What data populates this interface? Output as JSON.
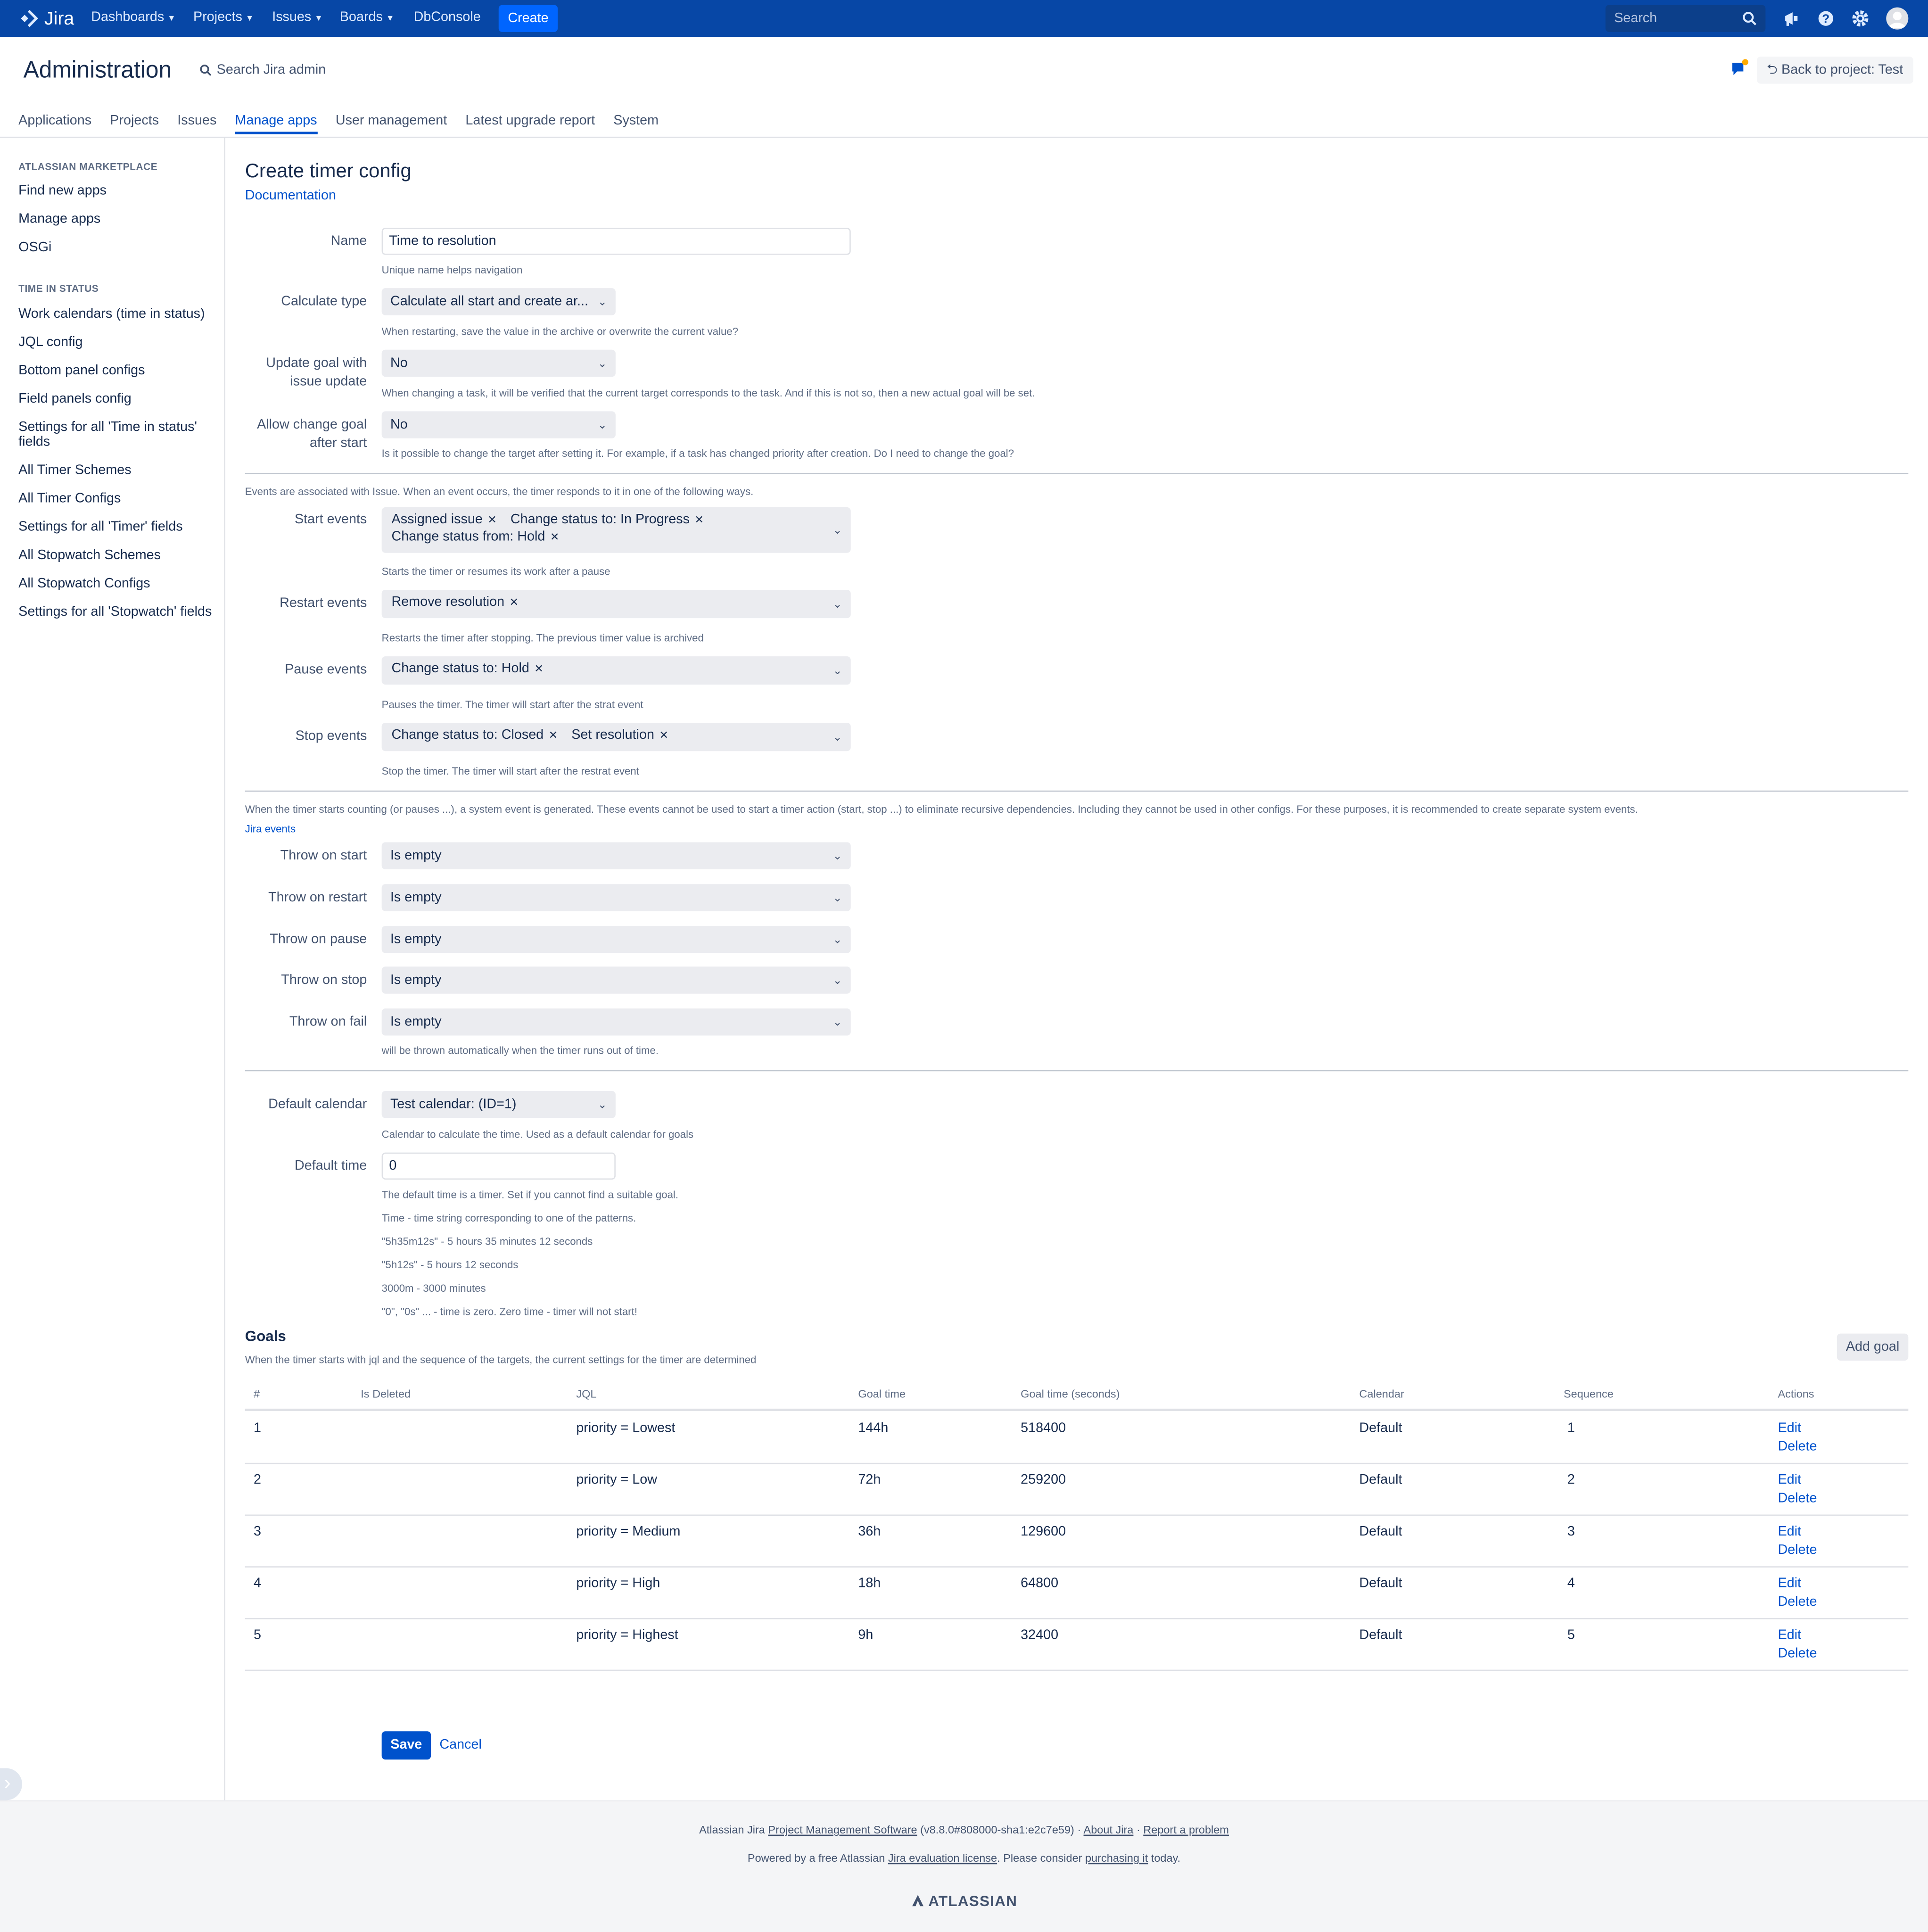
{
  "topnav": {
    "logo_text": "Jira",
    "items": [
      {
        "label": "Dashboards",
        "caret": "▾"
      },
      {
        "label": "Projects",
        "caret": "▾"
      },
      {
        "label": "Issues",
        "caret": "▾"
      },
      {
        "label": "Boards",
        "caret": "▾"
      },
      {
        "label": "DbConsole",
        "caret": ""
      }
    ],
    "create_label": "Create",
    "search_placeholder": "Search"
  },
  "admin": {
    "title": "Administration",
    "search_label": "Search Jira admin",
    "back_label": "Back to project: Test",
    "tabs": [
      "Applications",
      "Projects",
      "Issues",
      "Manage apps",
      "User management",
      "Latest upgrade report",
      "System"
    ]
  },
  "sidebar": {
    "section1": "ATLASSIAN MARKETPLACE",
    "links1": [
      "Find new apps",
      "Manage apps",
      "OSGi"
    ],
    "section2": "TIME IN STATUS",
    "links2": [
      "Work calendars (time in status)",
      "JQL config",
      "Bottom panel configs",
      "Field panels config",
      "Settings for all 'Time in status' fields",
      "All Timer Schemes",
      "All Timer Configs",
      "Settings for all 'Timer' fields",
      "All Stopwatch Schemes",
      "All Stopwatch Configs",
      "Settings for all 'Stopwatch' fields"
    ]
  },
  "form": {
    "title": "Create timer config",
    "doc_link": "Documentation",
    "name": {
      "label": "Name",
      "value": "Time to resolution",
      "help": "Unique name helps navigation"
    },
    "calc_type": {
      "label": "Calculate type",
      "value": "Calculate all start and create ar...",
      "help": "When restarting, save the value in the archive or overwrite the current value?"
    },
    "update_goal": {
      "label": "Update goal with issue update",
      "value": "No",
      "help": "When changing a task, it will be verified that the current target corresponds to the task. And if this is not so, then a new actual goal will be set."
    },
    "allow_change": {
      "label": "Allow change goal after start",
      "value": "No",
      "help": "Is it possible to change the target after setting it. For example, if a task has changed priority after creation. Do I need to change the goal?"
    },
    "events_note": "Events are associated with Issue. When an event occurs, the timer responds to it in one of the following ways.",
    "start_events": {
      "label": "Start events",
      "chips": [
        "Assigned issue",
        "Change status to: In Progress",
        "Change status from: Hold"
      ],
      "help": "Starts the timer or resumes its work after a pause"
    },
    "restart_events": {
      "label": "Restart events",
      "chips": [
        "Remove resolution"
      ],
      "help": "Restarts the timer after stopping. The previous timer value is archived"
    },
    "pause_events": {
      "label": "Pause events",
      "chips": [
        "Change status to: Hold"
      ],
      "help": "Pauses the timer. The timer will start after the strat event"
    },
    "stop_events": {
      "label": "Stop events",
      "chips": [
        "Change status to: Closed",
        "Set resolution"
      ],
      "help": "Stop the timer. The timer will start after the restrat event"
    },
    "system_note": "When the timer starts counting (or pauses ...), a system event is generated. These events cannot be used to start a timer action (start, stop ...) to eliminate recursive dependencies. Including they cannot be used in other configs. For these purposes, it is recommended to create separate system events.",
    "jira_events_link": "Jira events",
    "throws": [
      {
        "label": "Throw on start",
        "value": "Is empty"
      },
      {
        "label": "Throw on restart",
        "value": "Is empty"
      },
      {
        "label": "Throw on pause",
        "value": "Is empty"
      },
      {
        "label": "Throw on stop",
        "value": "Is empty"
      },
      {
        "label": "Throw on fail",
        "value": "Is empty"
      }
    ],
    "throw_fail_help": "will be thrown automatically when the timer runs out of time.",
    "default_calendar": {
      "label": "Default calendar",
      "value": "Test calendar: (ID=1)",
      "help": "Calendar to calculate the time. Used as a default calendar for goals"
    },
    "default_time": {
      "label": "Default time",
      "value": "0",
      "help": [
        "The default time is a timer. Set if you cannot find a suitable goal.",
        "Time - time string corresponding to one of the patterns.",
        "\"5h35m12s\" - 5 hours 35 minutes 12 seconds",
        "\"5h12s\" - 5 hours 12 seconds",
        "3000m - 3000 minutes",
        "\"0\", \"0s\" ... - time is zero. Zero time - timer will not start!"
      ]
    }
  },
  "goals": {
    "title": "Goals",
    "subtitle": "When the timer starts with jql and the sequence of the targets, the current settings for the timer are determined",
    "add_label": "Add goal",
    "columns": [
      "#",
      "Is Deleted",
      "JQL",
      "Goal time",
      "Goal time (seconds)",
      "Calendar",
      "Sequence",
      "Actions"
    ],
    "rows": [
      {
        "num": "1",
        "deleted": "",
        "jql": "priority = Lowest",
        "goal": "144h",
        "seconds": "518400",
        "calendar": "Default",
        "seq": "1"
      },
      {
        "num": "2",
        "deleted": "",
        "jql": "priority = Low",
        "goal": "72h",
        "seconds": "259200",
        "calendar": "Default",
        "seq": "2"
      },
      {
        "num": "3",
        "deleted": "",
        "jql": "priority = Medium",
        "goal": "36h",
        "seconds": "129600",
        "calendar": "Default",
        "seq": "3"
      },
      {
        "num": "4",
        "deleted": "",
        "jql": "priority = High",
        "goal": "18h",
        "seconds": "64800",
        "calendar": "Default",
        "seq": "4"
      },
      {
        "num": "5",
        "deleted": "",
        "jql": "priority = Highest",
        "goal": "9h",
        "seconds": "32400",
        "calendar": "Default",
        "seq": "5"
      }
    ],
    "edit_label": "Edit",
    "delete_label": "Delete"
  },
  "actions": {
    "save": "Save",
    "cancel": "Cancel"
  },
  "footer": {
    "line1_a": "Atlassian Jira ",
    "line1_link1": "Project Management Software",
    "line1_b": " (v8.8.0#808000-sha1:e2c7e59)",
    "line1_sep": " · ",
    "line1_link2": "About Jira",
    "line1_link3": "Report a problem",
    "line2_a": "Powered by a free Atlassian ",
    "line2_link1": "Jira evaluation license",
    "line2_b": ". Please consider ",
    "line2_link2": "purchasing it",
    "line2_c": " today.",
    "brand": "ATLASSIAN"
  },
  "colors": {
    "nav_bg": "#0747a6",
    "primary": "#0052cc",
    "create": "#0065ff"
  }
}
